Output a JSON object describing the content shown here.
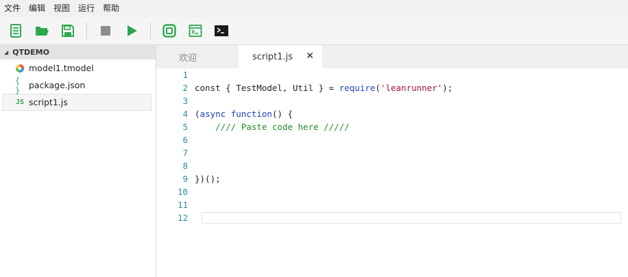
{
  "menu": [
    "文件",
    "编辑",
    "视图",
    "运行",
    "帮助"
  ],
  "toolbar": {
    "icons": [
      "new-file-icon",
      "open-folder-icon",
      "save-icon",
      "stop-icon",
      "run-icon",
      "record-icon",
      "console-window-icon",
      "terminal-icon"
    ],
    "colors": {
      "green": "#2ea650",
      "gray": "#8c8c8c",
      "dark": "#1a1a1a"
    }
  },
  "sidebar": {
    "project": "QTDEMO",
    "files": [
      {
        "name": "model1.tmodel",
        "icon": "model-icon"
      },
      {
        "name": "package.json",
        "icon": "json-icon"
      },
      {
        "name": "script1.js",
        "icon": "js-icon",
        "badge": "JS"
      }
    ],
    "json_badge": "{ }"
  },
  "tabs": [
    {
      "label": "欢迎",
      "active": false
    },
    {
      "label": "script1.js",
      "active": true,
      "close": "✕"
    }
  ],
  "editor": {
    "line_numbers": [
      "1",
      "2",
      "3",
      "4",
      "5",
      "6",
      "7",
      "8",
      "9",
      "10",
      "11",
      "12"
    ],
    "line2": {
      "p1": "const { TestModel, Util } = ",
      "fn": "require",
      "p2": "(",
      "str": "'leanrunner'",
      "p3": ");"
    },
    "line4": {
      "p1": "(",
      "kw1": "async",
      "sp": " ",
      "kw2": "function",
      "p2": "() {"
    },
    "line5": {
      "indent": "    ",
      "comment": "//// Paste code here /////"
    },
    "line9": "})();"
  }
}
